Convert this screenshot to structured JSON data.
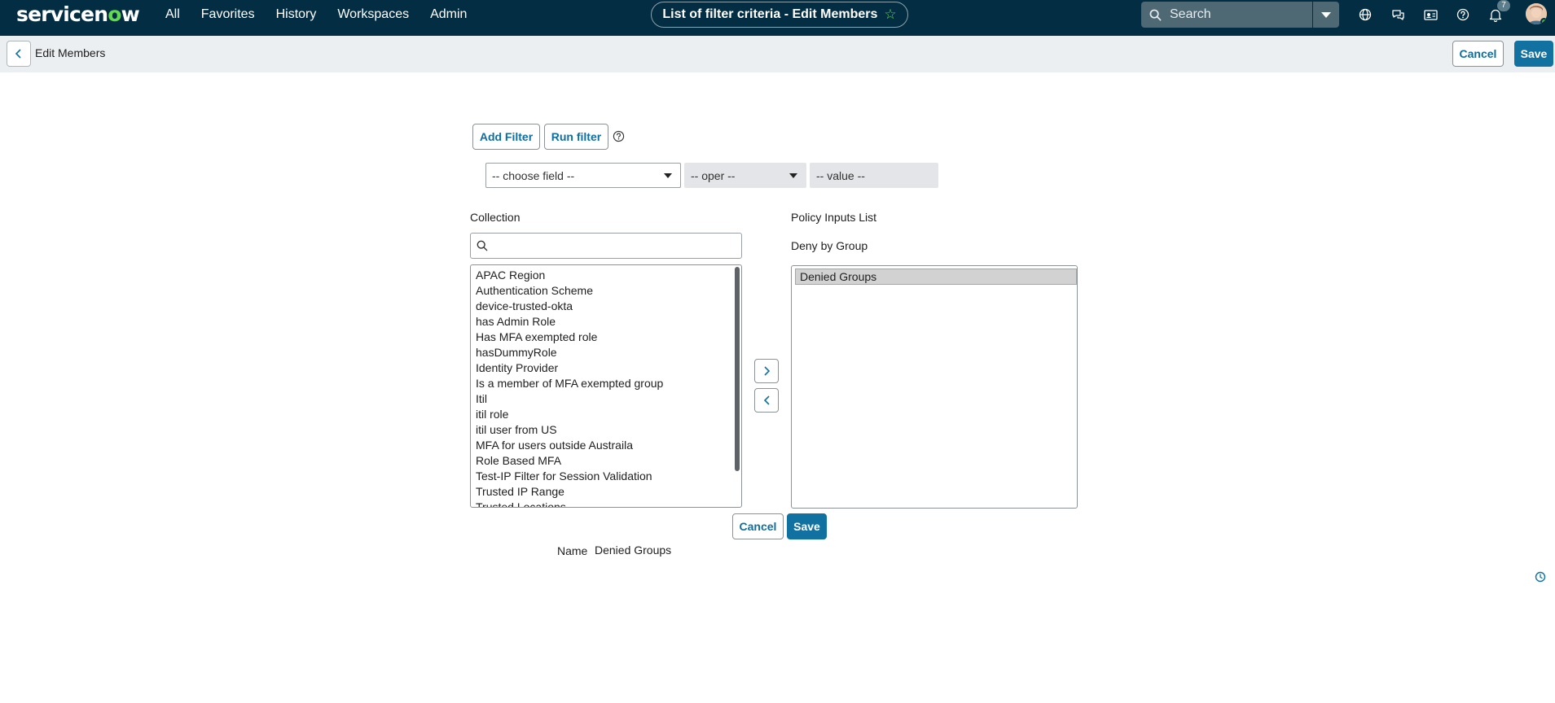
{
  "topnav": {
    "logo": {
      "part1": "servicen",
      "o": "o",
      "part2": "w"
    },
    "menu": [
      "All",
      "Favorites",
      "History",
      "Workspaces",
      "Admin"
    ],
    "page_title": "List of filter criteria - Edit Members",
    "search_placeholder": "Search",
    "notification_count": "7"
  },
  "header": {
    "title": "Edit Members",
    "cancel_label": "Cancel",
    "save_label": "Save"
  },
  "filter": {
    "add_filter_label": "Add Filter",
    "run_filter_label": "Run filter",
    "field_select": "-- choose field --",
    "oper_select": "-- oper --",
    "value_input": "-- value --"
  },
  "collection": {
    "label": "Collection",
    "search_value": "",
    "items": [
      "APAC Region",
      "Authentication Scheme",
      "device-trusted-okta",
      "has Admin Role",
      "Has MFA exempted role",
      "hasDummyRole",
      "Identity Provider",
      "Is a member of MFA exempted group",
      "Itil",
      "itil role",
      "itil user from US",
      "MFA for users outside Austraila",
      "Role Based MFA",
      "Test-IP Filter for Session Validation",
      "Trusted IP Range",
      "Trusted Locations"
    ]
  },
  "policy": {
    "label": "Policy Inputs List",
    "sublabel": "Deny by Group",
    "items": [
      "Denied Groups"
    ]
  },
  "form": {
    "cancel_label": "Cancel",
    "save_label": "Save",
    "name_label": "Name",
    "name_value": "Denied Groups"
  },
  "colors": {
    "nav_bg": "#032d42",
    "brand_green": "#62d84e",
    "primary": "#1171a0",
    "header_bg": "#eceff1"
  }
}
